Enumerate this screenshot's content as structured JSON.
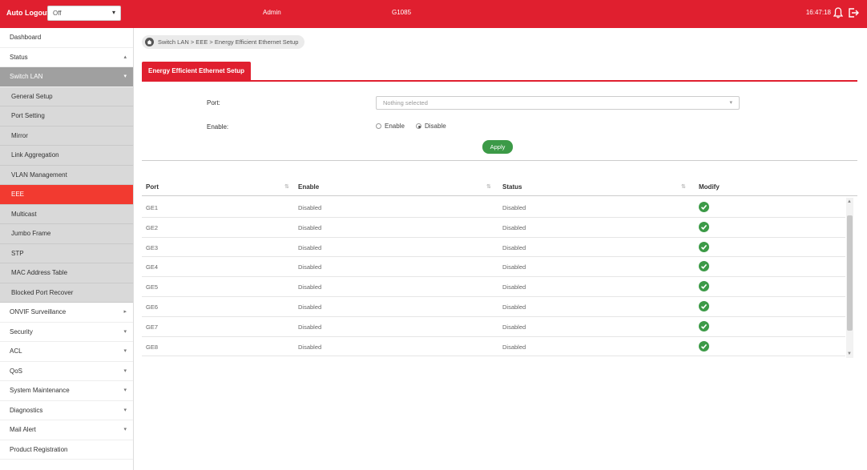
{
  "topbar": {
    "auto_logout_label": "Auto Logout:",
    "auto_logout_value": "Off",
    "user": "Admin",
    "model": "G1085",
    "time": "16:47:18"
  },
  "sidebar": {
    "items": [
      {
        "label": "Dashboard",
        "chevron": ""
      },
      {
        "label": "Status",
        "chevron": "▴"
      },
      {
        "label": "Switch LAN",
        "chevron": "▾"
      },
      {
        "label": "General Setup"
      },
      {
        "label": "Port Setting"
      },
      {
        "label": "Mirror"
      },
      {
        "label": "Link Aggregation"
      },
      {
        "label": "VLAN Management"
      },
      {
        "label": "EEE"
      },
      {
        "label": "Multicast"
      },
      {
        "label": "Jumbo Frame"
      },
      {
        "label": "STP"
      },
      {
        "label": "MAC Address Table"
      },
      {
        "label": "Blocked Port Recover"
      },
      {
        "label": "ONVIF Surveillance",
        "chevron": "▸"
      },
      {
        "label": "Security",
        "chevron": "▾"
      },
      {
        "label": "ACL",
        "chevron": "▾"
      },
      {
        "label": "QoS",
        "chevron": "▾"
      },
      {
        "label": "System Maintenance",
        "chevron": "▾"
      },
      {
        "label": "Diagnostics",
        "chevron": "▾"
      },
      {
        "label": "Mail Alert",
        "chevron": "▾"
      },
      {
        "label": "Product Registration",
        "chevron": ""
      }
    ]
  },
  "breadcrumb": "Switch LAN > EEE > Energy Efficient Ethernet Setup",
  "tab_label": "Energy Efficient Ethernet Setup",
  "form": {
    "port_label": "Port:",
    "port_placeholder": "Nothing selected",
    "enable_label": "Enable:",
    "enable_option": "Enable",
    "disable_option": "Disable",
    "selected": "Disable",
    "apply_label": "Apply"
  },
  "table": {
    "headers": [
      "Port",
      "Enable",
      "Status",
      "Modify"
    ],
    "rows": [
      {
        "port": "GE1",
        "enable": "Disabled",
        "status": "Disabled"
      },
      {
        "port": "GE2",
        "enable": "Disabled",
        "status": "Disabled"
      },
      {
        "port": "GE3",
        "enable": "Disabled",
        "status": "Disabled"
      },
      {
        "port": "GE4",
        "enable": "Disabled",
        "status": "Disabled"
      },
      {
        "port": "GE5",
        "enable": "Disabled",
        "status": "Disabled"
      },
      {
        "port": "GE6",
        "enable": "Disabled",
        "status": "Disabled"
      },
      {
        "port": "GE7",
        "enable": "Disabled",
        "status": "Disabled"
      },
      {
        "port": "GE8",
        "enable": "Disabled",
        "status": "Disabled"
      }
    ]
  },
  "colors": {
    "brand": "#e01f2f",
    "active_nav": "#f23a30",
    "apply": "#3c9a47"
  },
  "icons": {
    "dropdown": "chevron-down-icon",
    "notifications": "bell-icon",
    "logout": "logout-icon",
    "home": "home-icon",
    "modify": "check-circle-icon"
  }
}
